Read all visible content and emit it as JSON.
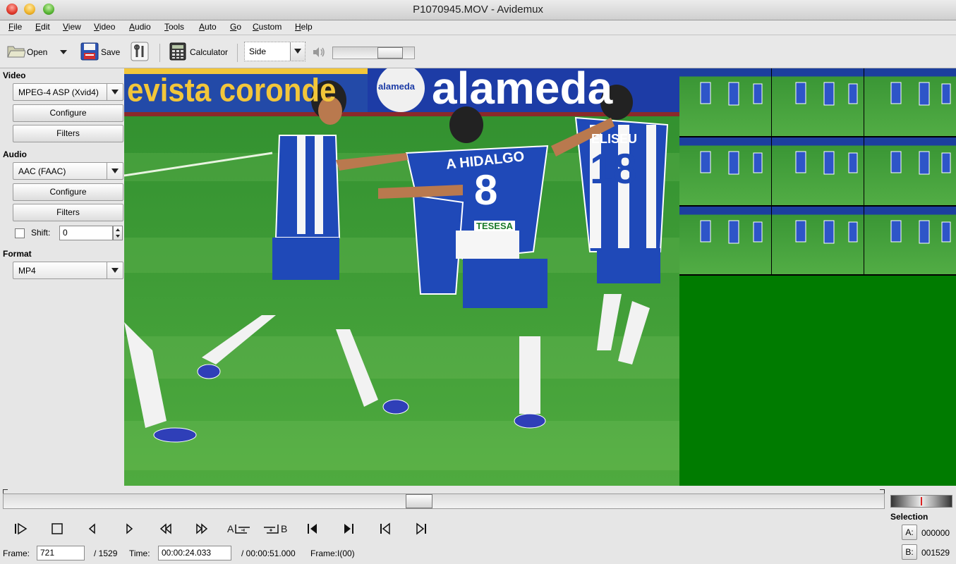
{
  "window": {
    "title": "P1070945.MOV - Avidemux"
  },
  "menu": [
    "File",
    "Edit",
    "View",
    "Video",
    "Audio",
    "Tools",
    "Auto",
    "Go",
    "Custom",
    "Help"
  ],
  "toolbar": {
    "open_label": "Open",
    "save_label": "Save",
    "calculator_label": "Calculator",
    "display_mode": "Side"
  },
  "sidebar": {
    "video_heading": "Video",
    "video_codec": "MPEG-4 ASP (Xvid4)",
    "video_configure": "Configure",
    "video_filters": "Filters",
    "audio_heading": "Audio",
    "audio_codec": "AAC (FAAC)",
    "audio_configure": "Configure",
    "audio_filters": "Filters",
    "shift_label": "Shift:",
    "shift_value": "0",
    "format_heading": "Format",
    "format_value": "MP4"
  },
  "video": {
    "banner_left": "evista coronde",
    "banner_logo": "alameda",
    "banner_main": "alameda",
    "jersey_8_name": "A HIDALGO",
    "jersey_8_number": "8",
    "jersey_18_name": "ELISEU",
    "jersey_18_number": "18",
    "sponsor": "TESESA"
  },
  "controls": {
    "ab_a": "A",
    "ab_b": "B"
  },
  "status": {
    "frame_label": "Frame:",
    "frame_value": "721",
    "frame_total": "/ 1529",
    "time_label": "Time:",
    "time_value": "00:00:24.033",
    "time_total": "/ 00:00:51.000",
    "frame_type": "Frame:I(00)"
  },
  "selection": {
    "heading": "Selection",
    "a_label": "A:",
    "a_value": "000000",
    "b_label": "B:",
    "b_value": "001529"
  },
  "progress": {
    "seek_fraction": 0.4715,
    "volume_fraction": 0.8
  }
}
